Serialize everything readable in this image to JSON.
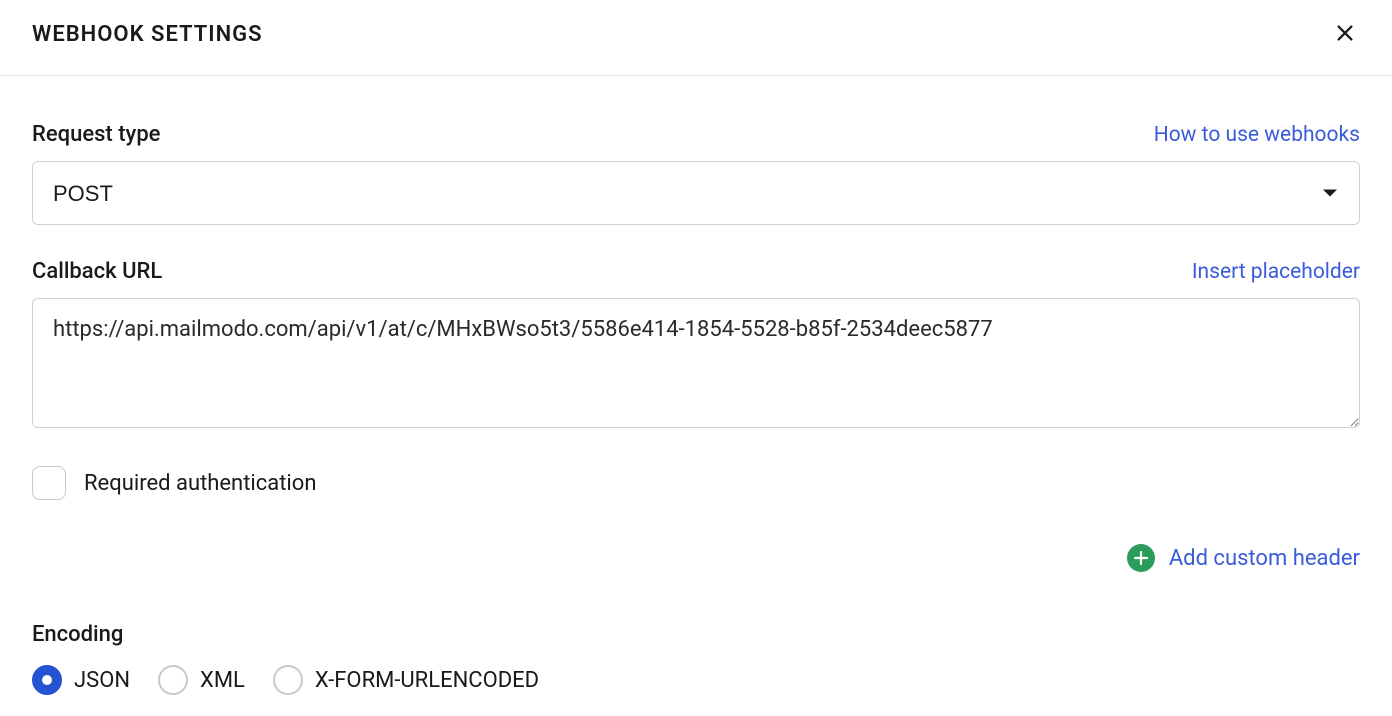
{
  "header": {
    "title": "WEBHOOK SETTINGS"
  },
  "requestType": {
    "label": "Request type",
    "helpLink": "How to use webhooks",
    "value": "POST"
  },
  "callbackUrl": {
    "label": "Callback URL",
    "insertLink": "Insert placeholder",
    "value": "https://api.mailmodo.com/api/v1/at/c/MHxBWso5t3/5586e414-1854-5528-b85f-2534deec5877"
  },
  "authCheckbox": {
    "label": "Required authentication",
    "checked": false
  },
  "customHeader": {
    "label": "Add custom header"
  },
  "encoding": {
    "label": "Encoding",
    "options": [
      {
        "label": "JSON",
        "checked": true
      },
      {
        "label": "XML",
        "checked": false
      },
      {
        "label": "X-FORM-URLENCODED",
        "checked": false
      }
    ]
  }
}
